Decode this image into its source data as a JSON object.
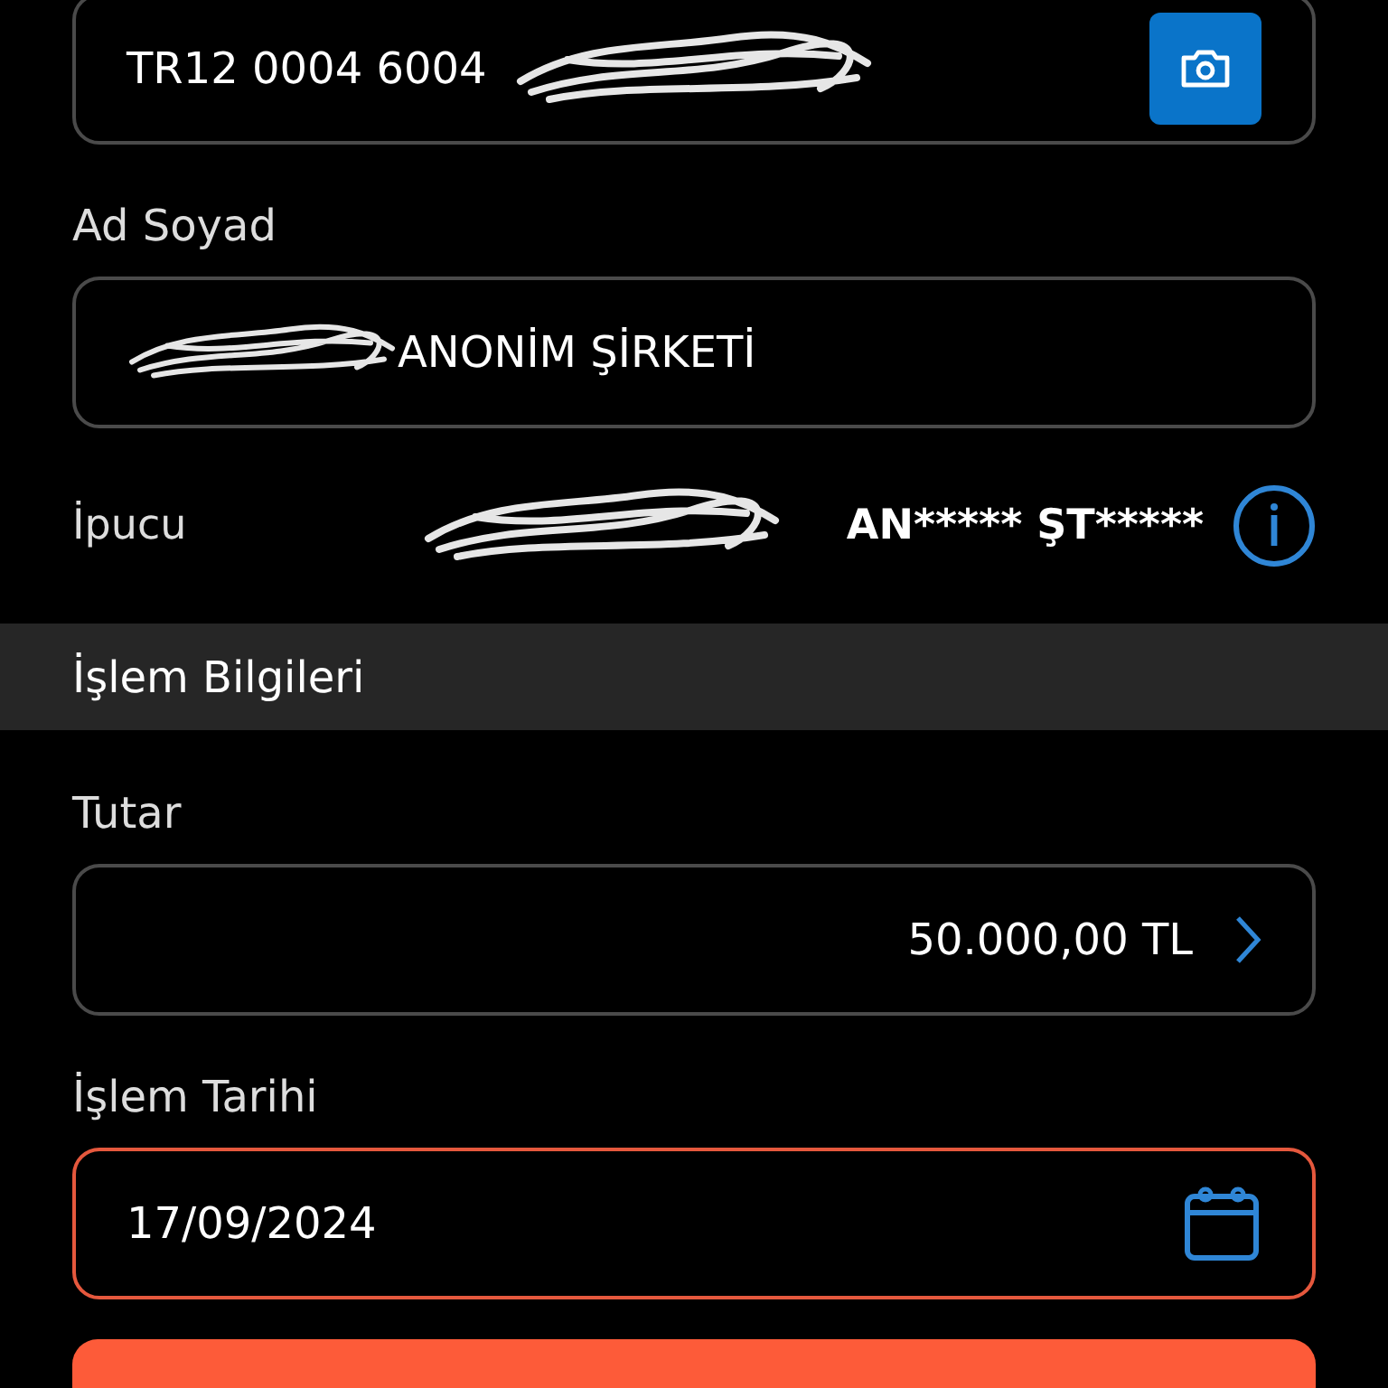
{
  "iban_field": {
    "value": "TR12 0004 6004",
    "redacted": true
  },
  "name_section": {
    "label": "Ad Soyad",
    "value": "ANONİM ŞİRKETİ",
    "redacted": true
  },
  "hint": {
    "label": "İpucu",
    "value": "AN***** ŞT*****",
    "redacted": true
  },
  "section_header": "İşlem Bilgileri",
  "amount": {
    "label": "Tutar",
    "value": "50.000,00 TL"
  },
  "date": {
    "label": "İşlem Tarihi",
    "value": "17/09/2024",
    "error": true
  }
}
